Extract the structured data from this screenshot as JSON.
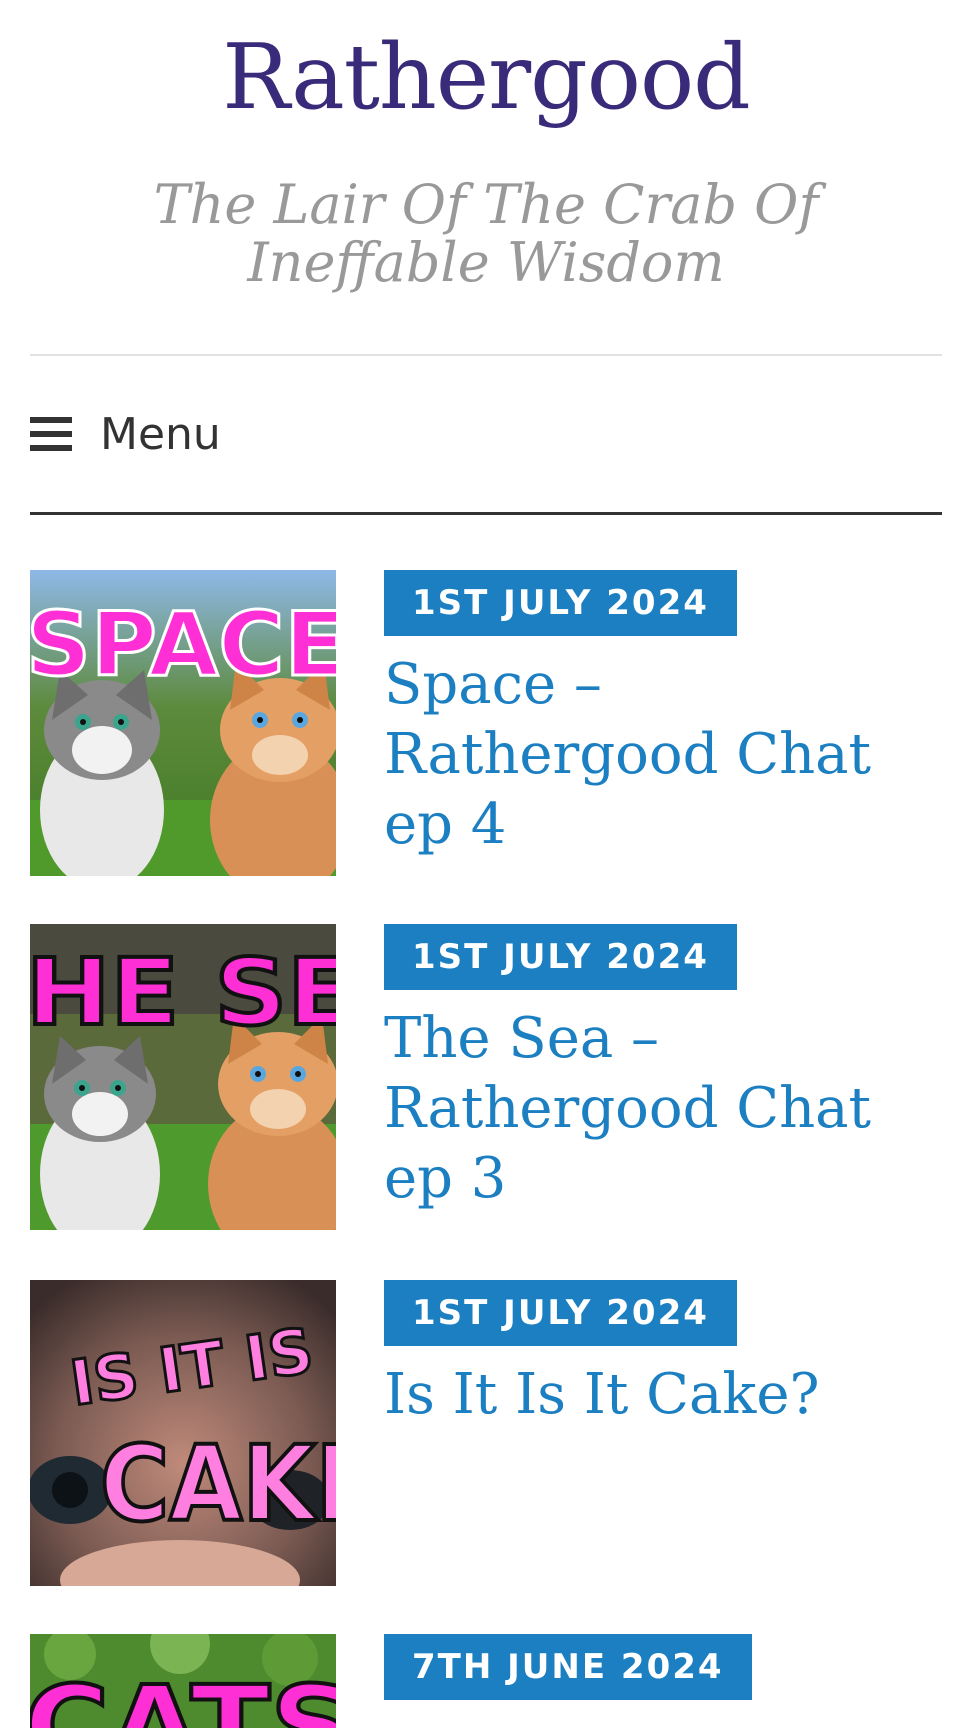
{
  "site": {
    "title": "Rathergood",
    "tagline": "The Lair Of The Crab Of Ineffable Wisdom"
  },
  "menu": {
    "label": "Menu",
    "icon": "hamburger-menu-icon"
  },
  "colors": {
    "title": "#3a2a7a",
    "tagline": "#999999",
    "accent": "#1b7fc1",
    "thumb_text": "#ff2fd6"
  },
  "posts": [
    {
      "date": "1ST JULY 2024",
      "title": "Space – Rathergood Chat ep 4",
      "thumb_text": "SPACE"
    },
    {
      "date": "1ST JULY 2024",
      "title": "The Sea – Rathergood Chat ep 3",
      "thumb_text": "HE SE"
    },
    {
      "date": "1ST JULY 2024",
      "title": "Is It Is It Cake?",
      "thumb_text_line1": "IS IT IS",
      "thumb_text_line2": "CAKE"
    },
    {
      "date": "7TH JUNE 2024",
      "thumb_text": "CATS"
    }
  ]
}
